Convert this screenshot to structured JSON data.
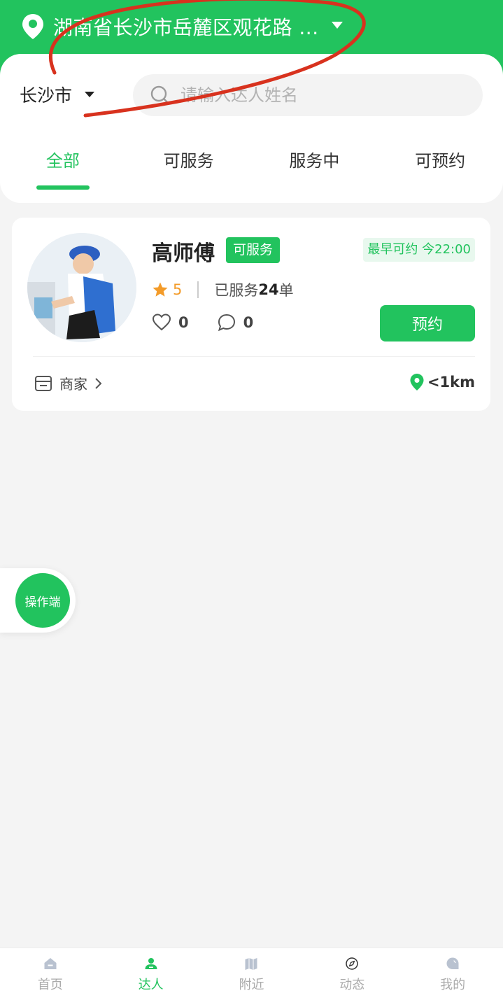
{
  "header": {
    "location": "湖南省长沙市岳麓区观花路 ..."
  },
  "filter": {
    "city": "长沙市",
    "search_placeholder": "请输入达人姓名"
  },
  "tabs": [
    {
      "label": "全部",
      "active": true
    },
    {
      "label": "可服务",
      "active": false
    },
    {
      "label": "服务中",
      "active": false
    },
    {
      "label": "可预约",
      "active": false
    }
  ],
  "worker": {
    "name": "高师傅",
    "status": "可服务",
    "earliest": "最早可约 今22:00",
    "rating": "5",
    "served_prefix": "已服务",
    "served_count": "24",
    "served_suffix": "单",
    "likes": "0",
    "comments": "0",
    "book_label": "预约",
    "merchant_label": "商家",
    "distance": "<1km"
  },
  "float_button": "操作端",
  "bottom_nav": [
    {
      "label": "首页",
      "icon": "home-icon"
    },
    {
      "label": "达人",
      "icon": "person-icon"
    },
    {
      "label": "附近",
      "icon": "map-icon"
    },
    {
      "label": "动态",
      "icon": "compass-icon"
    },
    {
      "label": "我的",
      "icon": "profile-icon"
    }
  ],
  "colors": {
    "primary": "#22c35e",
    "rating": "#f39b29",
    "background": "#f4f4f4"
  }
}
